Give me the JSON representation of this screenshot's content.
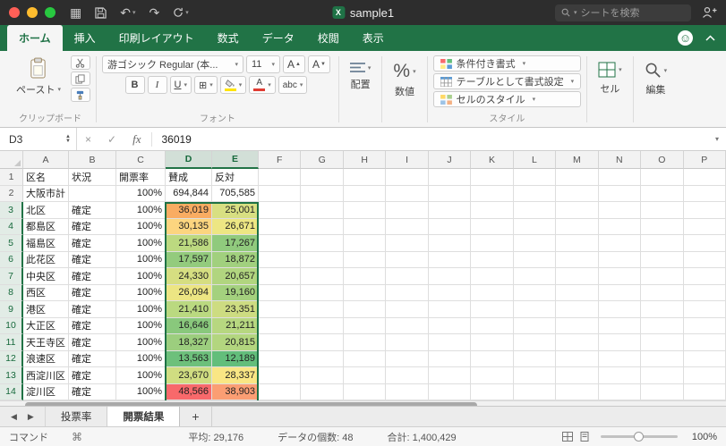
{
  "colors": {
    "accent": "#217346",
    "selection_border": "#1e7145"
  },
  "glyphs": {
    "grid": "▦",
    "undo": "↶",
    "redo": "↷",
    "caret": "▾",
    "nav_left": "◀",
    "nav_right": "▶",
    "plus": "+",
    "smiley": "☺",
    "x": "×",
    "check": "✓",
    "borders": "⊞",
    "percent": "%",
    "command": "⌘",
    "font_up": "▲",
    "font_down": "▼",
    "A": "A"
  },
  "titlebar": {
    "title": "sample1",
    "search_placeholder": "シートを検索"
  },
  "ribbon_tabs": [
    {
      "label": "ホーム",
      "active": true
    },
    {
      "label": "挿入"
    },
    {
      "label": "印刷レイアウト"
    },
    {
      "label": "数式"
    },
    {
      "label": "データ"
    },
    {
      "label": "校閲"
    },
    {
      "label": "表示"
    }
  ],
  "ribbon": {
    "paste": "ペースト",
    "group_clipboard": "クリップボード",
    "font_name": "游ゴシック Regular (本...",
    "font_size": "11",
    "group_font": "フォント",
    "bold": "B",
    "italic": "I",
    "underline": "U",
    "abc": "abc",
    "align": "配置",
    "number": "数値",
    "conditional": "条件付き書式",
    "format_table": "テーブルとして書式設定",
    "cell_styles": "セルのスタイル",
    "group_styles": "スタイル",
    "cells": "セル",
    "edit": "編集"
  },
  "formula_bar": {
    "cell_ref": "D3",
    "fx": "fx",
    "value": "36019"
  },
  "grid": {
    "columns": [
      {
        "label": "A"
      },
      {
        "label": "B"
      },
      {
        "label": "C"
      },
      {
        "label": "D",
        "selected": true
      },
      {
        "label": "E",
        "selected": true
      },
      {
        "label": "F"
      },
      {
        "label": "G"
      },
      {
        "label": "H"
      },
      {
        "label": "I"
      },
      {
        "label": "J"
      },
      {
        "label": "K"
      },
      {
        "label": "L"
      },
      {
        "label": "M"
      },
      {
        "label": "N"
      },
      {
        "label": "O"
      },
      {
        "label": "P"
      }
    ],
    "rows": [
      {
        "n": "1",
        "hdr": true,
        "a": "区名",
        "b": "状況",
        "c": "開票率",
        "d": "賛成",
        "e": "反対"
      },
      {
        "n": "2",
        "a": "大阪市計",
        "b": "",
        "c": "100%",
        "d": "694,844",
        "e": "705,585"
      },
      {
        "n": "3",
        "sel": true,
        "a": "北区",
        "b": "確定",
        "c": "100%",
        "d": "36,019",
        "e": "25,001",
        "dbg": "#F9AC62",
        "ebg": "#D8DF82"
      },
      {
        "n": "4",
        "sel": true,
        "a": "都島区",
        "b": "確定",
        "c": "100%",
        "d": "30,135",
        "e": "26,671",
        "dbg": "#FCD57F",
        "ebg": "#EDE683"
      },
      {
        "n": "5",
        "sel": true,
        "a": "福島区",
        "b": "確定",
        "c": "100%",
        "d": "21,586",
        "e": "17,267",
        "dbg": "#BCD980",
        "ebg": "#90CA7D"
      },
      {
        "n": "6",
        "sel": true,
        "a": "此花区",
        "b": "確定",
        "c": "100%",
        "d": "17,597",
        "e": "18,872",
        "dbg": "#93CB7D",
        "ebg": "#A1D07E"
      },
      {
        "n": "7",
        "sel": true,
        "a": "中央区",
        "b": "確定",
        "c": "100%",
        "d": "24,330",
        "e": "20,657",
        "dbg": "#D6DE81",
        "ebg": "#B1D57F"
      },
      {
        "n": "8",
        "sel": true,
        "a": "西区",
        "b": "確定",
        "c": "100%",
        "d": "26,094",
        "e": "19,160",
        "dbg": "#ECE583",
        "ebg": "#A4D17E"
      },
      {
        "n": "9",
        "sel": true,
        "a": "港区",
        "b": "確定",
        "c": "100%",
        "d": "21,410",
        "e": "23,351",
        "dbg": "#BAD980",
        "ebg": "#CDDC81"
      },
      {
        "n": "10",
        "sel": true,
        "a": "大正区",
        "b": "確定",
        "c": "100%",
        "d": "16,646",
        "e": "21,211",
        "dbg": "#89C87C",
        "ebg": "#B7D780"
      },
      {
        "n": "11",
        "sel": true,
        "a": "天王寺区",
        "b": "確定",
        "c": "100%",
        "d": "18,327",
        "e": "20,815",
        "dbg": "#9CCE7E",
        "ebg": "#B3D67F"
      },
      {
        "n": "12",
        "sel": true,
        "a": "浪速区",
        "b": "確定",
        "c": "100%",
        "d": "13,563",
        "e": "12,189",
        "dbg": "#6DC07B",
        "ebg": "#63BE7B"
      },
      {
        "n": "13",
        "sel": true,
        "a": "西淀川区",
        "b": "確定",
        "c": "100%",
        "d": "23,670",
        "e": "28,337",
        "dbg": "#D0DD81",
        "ebg": "#F9E684"
      },
      {
        "n": "14",
        "sel": true,
        "a": "淀川区",
        "b": "確定",
        "c": "100%",
        "d": "48,566",
        "e": "38,903",
        "dbg": "#F8696B",
        "ebg": "#FB9E73"
      },
      {
        "n": "15",
        "sel": true,
        "a": "",
        "b": "",
        "c": "",
        "d": "",
        "e": "",
        "dbg": "#F97F70",
        "ebg": "#D3DD81"
      }
    ]
  },
  "sheet_tabs": [
    {
      "label": "投票率"
    },
    {
      "label": "開票結果",
      "active": true
    }
  ],
  "status_bar": {
    "mode": "コマンド",
    "stats": [
      {
        "label": "平均:",
        "value": "29,176"
      },
      {
        "label": "データの個数:",
        "value": "48"
      },
      {
        "label": "合計:",
        "value": "1,400,429"
      }
    ],
    "zoom": "100%"
  }
}
